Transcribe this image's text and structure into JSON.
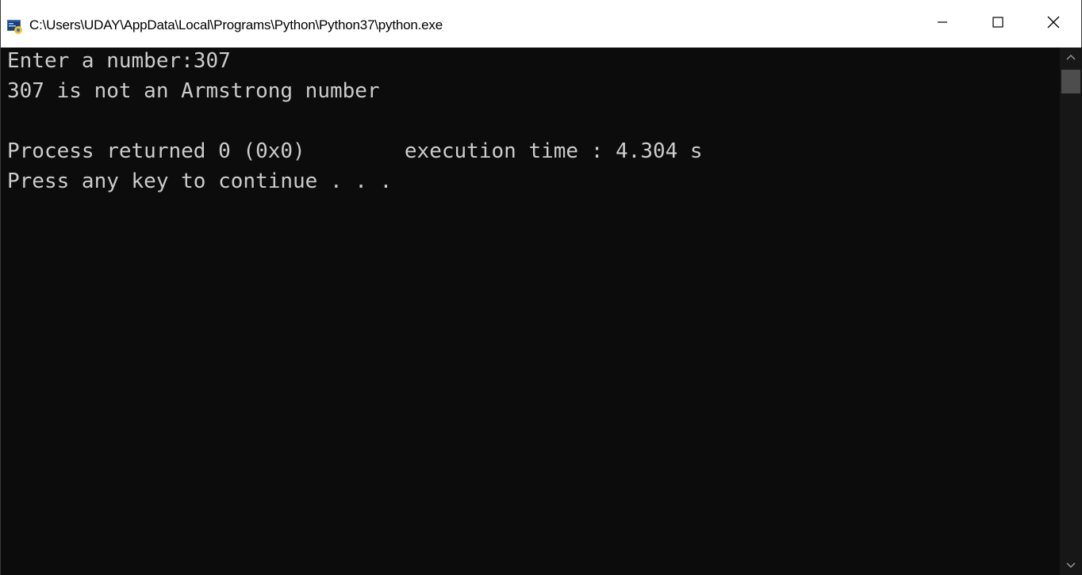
{
  "window": {
    "title": "C:\\Users\\UDAY\\AppData\\Local\\Programs\\Python\\Python37\\python.exe",
    "app_icon": "python-console-icon",
    "controls": {
      "minimize_icon": "minimize-icon",
      "maximize_icon": "maximize-icon",
      "close_icon": "close-icon"
    }
  },
  "console": {
    "lines": [
      "Enter a number:307",
      "307 is not an Armstrong number",
      "Process returned 0 (0x0)        execution time : 4.304 s",
      "Press any key to continue . . ."
    ],
    "text_color": "#cccccc",
    "background_color": "#0c0c0c"
  },
  "scrollbar": {
    "up_icon": "chevron-up-icon",
    "down_icon": "chevron-down-icon"
  }
}
